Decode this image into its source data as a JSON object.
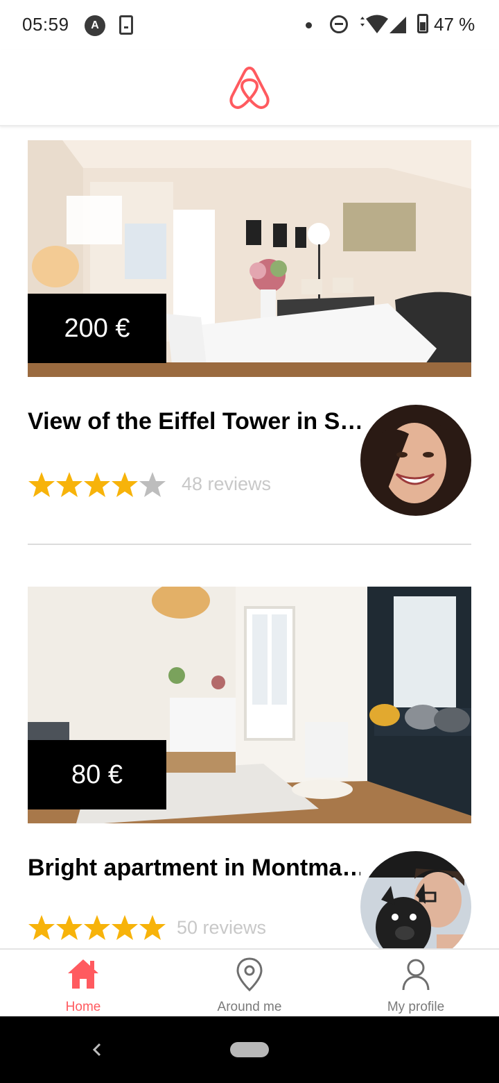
{
  "status_bar": {
    "time": "05:59",
    "battery": "47 %",
    "icons": [
      "a-badge-icon",
      "download-icon",
      "notification-dot-icon",
      "do-not-disturb-icon",
      "wifi-icon",
      "signal-icon",
      "battery-icon"
    ]
  },
  "header": {
    "logo": "airbnb-logo-icon",
    "brand_color": "#ff5a5f"
  },
  "listings": [
    {
      "price": "200 €",
      "title": "View of the Eiffel Tower in S…",
      "rating": 4,
      "max_rating": 5,
      "reviews": "48 reviews",
      "photo": "living-room-photo",
      "avatar": "host-avatar-woman-smiling"
    },
    {
      "price": "80 €",
      "title": "Bright apartment in Montma…",
      "rating": 5,
      "max_rating": 5,
      "reviews": "50 reviews",
      "photo": "bright-living-room-photo",
      "avatar": "host-avatar-with-dog"
    }
  ],
  "colors": {
    "star_filled": "#f7b30a",
    "star_empty": "#bdbdbd",
    "accent": "#ff5a5f"
  },
  "tabs": [
    {
      "label": "Home",
      "icon": "home-icon",
      "active": true
    },
    {
      "label": "Around me",
      "icon": "location-pin-icon",
      "active": false
    },
    {
      "label": "My profile",
      "icon": "user-icon",
      "active": false
    }
  ],
  "nav_bar": {
    "icons": [
      "back-icon",
      "home-pill-icon"
    ]
  }
}
